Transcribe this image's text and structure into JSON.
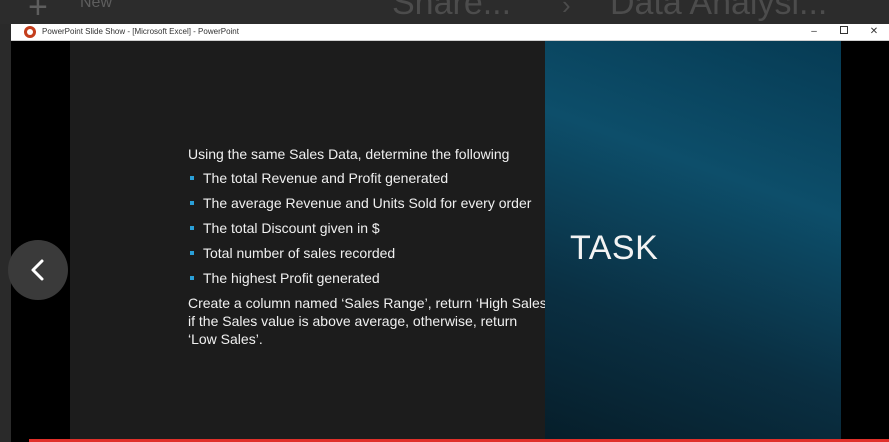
{
  "background_bar": {
    "new_label": "New",
    "share_label": "Share...",
    "analysis_label": "Data Analysi..."
  },
  "window": {
    "title": "PowerPoint Slide Show - [Microsoft Excel] - PowerPoint",
    "controls": {
      "minimize": "–",
      "close": "✕"
    }
  },
  "slide": {
    "intro": "Using the same Sales Data, determine the following",
    "bullets": [
      "The total Revenue and Profit generated",
      "The average Revenue and Units Sold for every order",
      "The total Discount given in $",
      "Total number of sales recorded",
      "The highest Profit generated"
    ],
    "closing": "Create a column named ‘Sales Range’, return ‘High Sales’\nif the Sales value is above average, otherwise, return\n‘Low Sales’.",
    "task_title": "TASK",
    "accent_color": "#2aa0d8",
    "panel_color": "#0d4e6a"
  },
  "player": {
    "progress_color": "#e0302a"
  }
}
